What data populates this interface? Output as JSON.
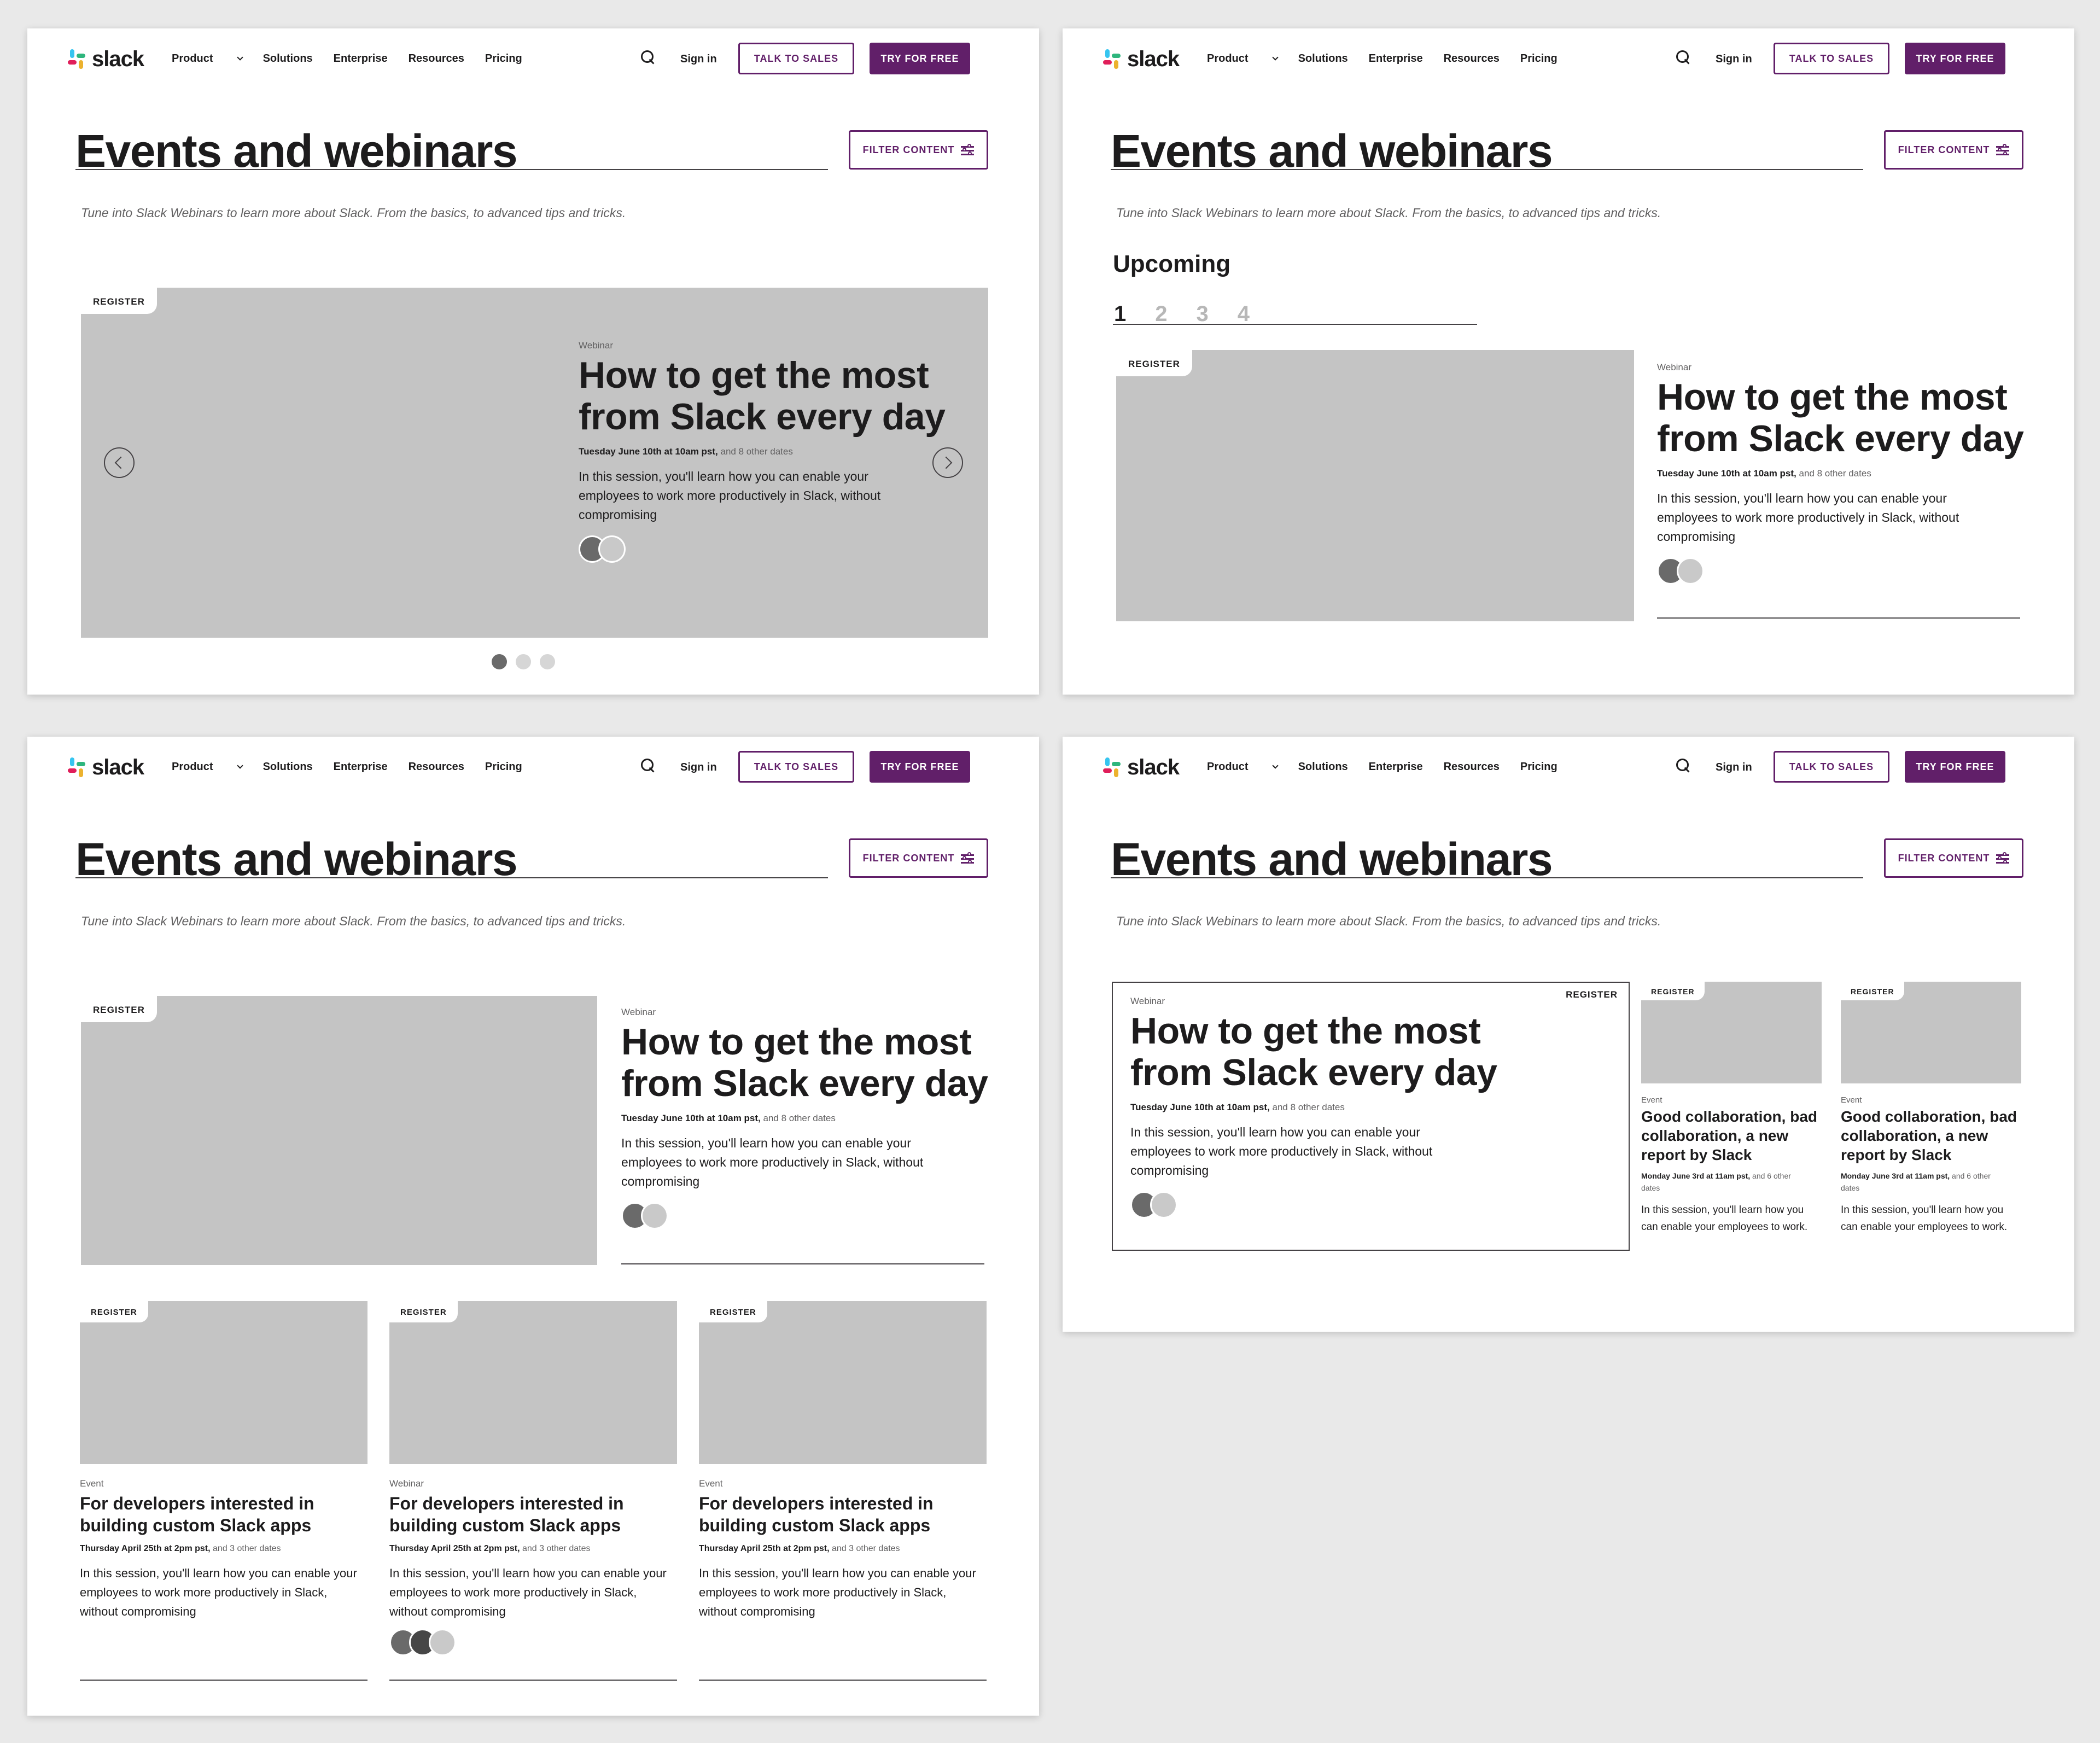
{
  "nav": {
    "logo_text": "slack",
    "links": [
      "Product",
      "Solutions",
      "Enterprise",
      "Resources",
      "Pricing"
    ],
    "signin": "Sign in",
    "talk_to_sales": "TALK TO SALES",
    "try_free": "TRY FOR FREE",
    "logo_colors": [
      "#36c5f0",
      "#2eb67d",
      "#ecb22e",
      "#e01e5a"
    ]
  },
  "page": {
    "title": "Events and webinars",
    "filter_label": "FILTER CONTENT",
    "subtitle": "Tune into Slack Webinars to learn more about Slack. From the basics, to advanced tips and tricks."
  },
  "featured": {
    "register": "REGISTER",
    "kind": "Webinar",
    "title": "How to get the most from Slack every day",
    "date_bold": "Tuesday June 10th at 10am pst,",
    "date_rest": " and 8 other dates",
    "description": "In this session, you'll learn how you can enable your employees to work more productively in Slack, without compromising"
  },
  "carousel": {
    "dots": 3,
    "active_dot": 1
  },
  "upcoming": {
    "heading": "Upcoming",
    "pages": [
      "1",
      "2",
      "3",
      "4"
    ],
    "current_page": "1"
  },
  "small_cards": [
    {
      "register": "REGISTER",
      "kind": "Event",
      "title": "For developers interested in building custom Slack apps",
      "date_bold": "Thursday April 25th at 2pm pst,",
      "date_rest": " and 3 other dates",
      "description": "In this session, you'll learn how you can enable your employees to work more productively in Slack, without compromising"
    },
    {
      "register": "REGISTER",
      "kind": "Webinar",
      "title": "For developers interested in building custom Slack apps",
      "date_bold": "Thursday April 25th at 2pm pst,",
      "date_rest": " and 3 other dates",
      "description": "In this session, you'll learn how you can enable your employees to work more productively in Slack, without compromising"
    },
    {
      "register": "REGISTER",
      "kind": "Event",
      "title": "For developers interested in building custom Slack apps",
      "date_bold": "Thursday April 25th at 2pm pst,",
      "date_rest": " and 3 other dates",
      "description": "In this session, you'll learn how you can enable your employees to work more productively in Slack, without compromising"
    }
  ],
  "side_cards": [
    {
      "register": "REGISTER",
      "kind": "Event",
      "title": "Good collaboration, bad collaboration, a new report by Slack",
      "date_bold": "Monday June 3rd at 11am pst,",
      "date_rest": " and 6 other dates",
      "description": "In this session, you'll learn how you can enable your employees to work."
    },
    {
      "register": "REGISTER",
      "kind": "Event",
      "title": "Good collaboration, bad collaboration, a new report by Slack",
      "date_bold": "Monday June 3rd at 11am pst,",
      "date_rest": " and 6 other dates",
      "description": "In this session, you'll learn how you can enable your employees to work."
    }
  ]
}
